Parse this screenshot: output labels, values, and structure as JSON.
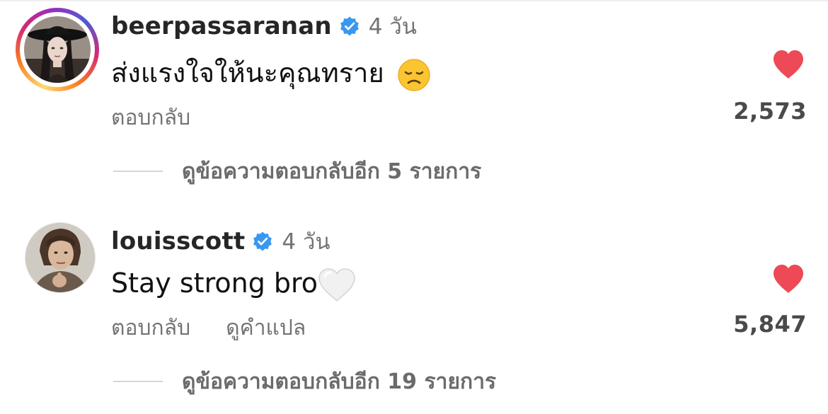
{
  "comments": [
    {
      "username": "beerpassaranan",
      "verified": true,
      "time": "4 วัน",
      "text": "ส่งแรงใจให้นะคุณทราย",
      "emoji": "disappointed-face-emoji",
      "reply_label": "ตอบกลับ",
      "like_count": "2,573",
      "liked": true,
      "view_replies": "ดูข้อความตอบกลับอีก 5 รายการ",
      "avatar_story_ring": true
    },
    {
      "username": "louisscott",
      "verified": true,
      "time": "4 วัน",
      "text": "Stay strong bro",
      "emoji": "white-heart-emoji",
      "reply_label": "ตอบกลับ",
      "translate_label": "ดูคำแปล",
      "like_count": "5,847",
      "liked": true,
      "view_replies": "ดูข้อความตอบกลับอีก 19 รายการ",
      "avatar_story_ring": false
    }
  ],
  "colors": {
    "username": "#262626",
    "meta": "#737373",
    "heart": "#ed4956",
    "verified": "#3897f0"
  }
}
